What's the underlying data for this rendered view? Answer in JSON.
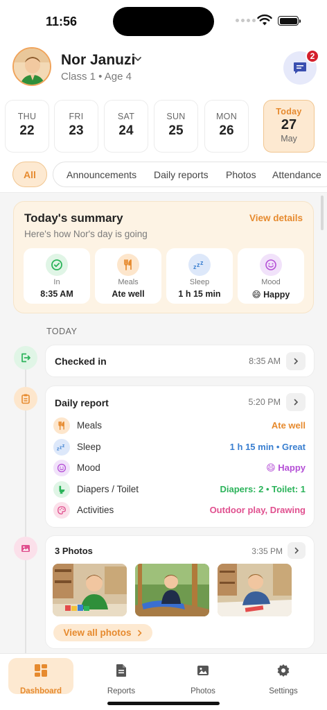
{
  "status_bar": {
    "time": "11:56"
  },
  "profile": {
    "name": "Nor Januzi",
    "class_age": "Class 1 • Age 4",
    "message_badge": "2"
  },
  "dates": [
    {
      "dow": "THU",
      "num": "22"
    },
    {
      "dow": "FRI",
      "num": "23"
    },
    {
      "dow": "SAT",
      "num": "24"
    },
    {
      "dow": "SUN",
      "num": "25"
    },
    {
      "dow": "MON",
      "num": "26"
    },
    {
      "dow": "Today",
      "num": "27",
      "month": "May"
    }
  ],
  "filters": [
    "All",
    "Announcements",
    "Daily reports",
    "Photos",
    "Attendance"
  ],
  "summary": {
    "title": "Today's summary",
    "subtitle": "Here's how Nor's day is going",
    "view_details": "View details",
    "stats": [
      {
        "icon": "check-circle-icon",
        "label": "In",
        "value": "8:35 AM"
      },
      {
        "icon": "fork-knife-icon",
        "label": "Meals",
        "value": "Ate well"
      },
      {
        "icon": "zzz-icon",
        "label": "Sleep",
        "value": "1 h 15 min"
      },
      {
        "icon": "smile-icon",
        "label": "Mood",
        "value": "😄 Happy"
      }
    ]
  },
  "section_label": "TODAY",
  "checked_in": {
    "title": "Checked in",
    "time": "8:35 AM"
  },
  "daily_report": {
    "title": "Daily report",
    "time": "5:20 PM",
    "rows": [
      {
        "icon": "fork-knife-icon",
        "label": "Meals",
        "value": "Ate well",
        "color": "#e68a2e"
      },
      {
        "icon": "zzz-icon",
        "label": "Sleep",
        "value": "1 h 15 min • Great",
        "color": "#3a7fd0"
      },
      {
        "icon": "smile-icon",
        "label": "Mood",
        "value": "😄 Happy",
        "color": "#b44fd6"
      },
      {
        "icon": "potty-icon",
        "label": "Diapers / Toilet",
        "value": "Diapers: 2 • Toilet: 1",
        "color": "#2bb35a"
      },
      {
        "icon": "palette-icon",
        "label": "Activities",
        "value": "Outdoor play, Drawing",
        "color": "#e0508f"
      }
    ]
  },
  "photos": {
    "title": "3 Photos",
    "time": "3:35 PM",
    "view_all": "View all photos"
  },
  "bottom_nav": [
    {
      "icon": "dashboard-icon",
      "label": "Dashboard"
    },
    {
      "icon": "report-icon",
      "label": "Reports"
    },
    {
      "icon": "photo-icon",
      "label": "Photos"
    },
    {
      "icon": "gear-icon",
      "label": "Settings"
    }
  ],
  "colors": {
    "accent": "#e68a2e",
    "accent_soft": "#fde9d1"
  }
}
